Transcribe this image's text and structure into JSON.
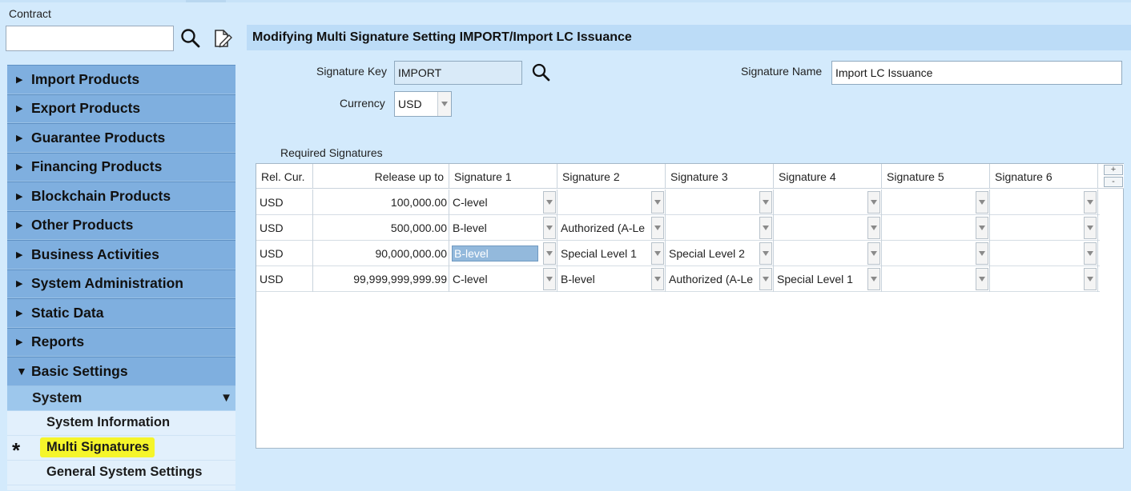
{
  "sidebar": {
    "contract_label": "Contract",
    "contract_value": "",
    "nav": [
      {
        "label": "Import Products"
      },
      {
        "label": "Export Products"
      },
      {
        "label": "Guarantee Products"
      },
      {
        "label": "Financing Products"
      },
      {
        "label": "Blockchain Products"
      },
      {
        "label": "Other Products"
      },
      {
        "label": "Business Activities"
      },
      {
        "label": "System Administration"
      },
      {
        "label": "Static Data"
      },
      {
        "label": "Reports"
      },
      {
        "label": "Basic Settings"
      }
    ],
    "sub_section": "System",
    "leaves": [
      "System Information",
      "Multi Signatures",
      "General System Settings"
    ],
    "active_marker": "*"
  },
  "page": {
    "title": "Modifying Multi Signature Setting IMPORT/Import LC Issuance"
  },
  "form": {
    "signature_key_label": "Signature Key",
    "signature_key_value": "IMPORT",
    "signature_name_label": "Signature Name",
    "signature_name_value": "Import LC Issuance",
    "currency_label": "Currency",
    "currency_value": "USD"
  },
  "grid": {
    "title": "Required Signatures",
    "headers": [
      "Rel. Cur.",
      "Release up to",
      "Signature 1",
      "Signature 2",
      "Signature 3",
      "Signature 4",
      "Signature 5",
      "Signature 6"
    ],
    "plus": "+",
    "minus": "-",
    "rows": [
      {
        "cur": "USD",
        "release": "100,000.00",
        "sigs": [
          "C-level",
          "",
          "",
          "",
          "",
          ""
        ]
      },
      {
        "cur": "USD",
        "release": "500,000.00",
        "sigs": [
          "B-level",
          "Authorized (A-Le",
          "",
          "",
          "",
          ""
        ]
      },
      {
        "cur": "USD",
        "release": "90,000,000.00",
        "sigs": [
          "B-level",
          "Special Level 1",
          "Special Level 2",
          "",
          "",
          ""
        ]
      },
      {
        "cur": "USD",
        "release": "99,999,999,999.99",
        "sigs": [
          "C-level",
          "B-level",
          "Authorized (A-Le",
          "Special Level 1",
          "",
          ""
        ]
      }
    ]
  },
  "colors": {
    "background": "#d3eafc",
    "nav_item": "#7fafdf",
    "header_bar": "#bcdcf7",
    "highlight": "#f5f52a"
  }
}
